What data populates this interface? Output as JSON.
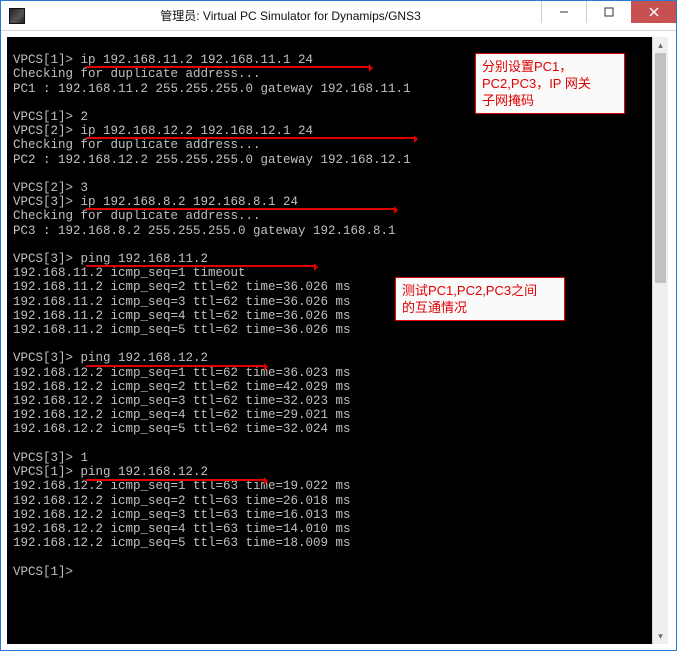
{
  "window": {
    "title": "管理员:  Virtual PC Simulator for Dynamips/GNS3"
  },
  "annotations": {
    "a1": "分别设置PC1，\nPC2,PC3，IP 网关\n子网掩码",
    "a2": "测试PC1,PC2,PC3之间\n的互通情况"
  },
  "terminal": {
    "lines": [
      "",
      "VPCS[1]> ip 192.168.11.2 192.168.11.1 24",
      "Checking for duplicate address...",
      "PC1 : 192.168.11.2 255.255.255.0 gateway 192.168.11.1",
      "",
      "VPCS[1]> 2",
      "VPCS[2]> ip 192.168.12.2 192.168.12.1 24",
      "Checking for duplicate address...",
      "PC2 : 192.168.12.2 255.255.255.0 gateway 192.168.12.1",
      "",
      "VPCS[2]> 3",
      "VPCS[3]> ip 192.168.8.2 192.168.8.1 24",
      "Checking for duplicate address...",
      "PC3 : 192.168.8.2 255.255.255.0 gateway 192.168.8.1",
      "",
      "VPCS[3]> ping 192.168.11.2",
      "192.168.11.2 icmp_seq=1 timeout",
      "192.168.11.2 icmp_seq=2 ttl=62 time=36.026 ms",
      "192.168.11.2 icmp_seq=3 ttl=62 time=36.026 ms",
      "192.168.11.2 icmp_seq=4 ttl=62 time=36.026 ms",
      "192.168.11.2 icmp_seq=5 ttl=62 time=36.026 ms",
      "",
      "VPCS[3]> ping 192.168.12.2",
      "192.168.12.2 icmp_seq=1 ttl=62 time=36.023 ms",
      "192.168.12.2 icmp_seq=2 ttl=62 time=42.029 ms",
      "192.168.12.2 icmp_seq=3 ttl=62 time=32.023 ms",
      "192.168.12.2 icmp_seq=4 ttl=62 time=29.021 ms",
      "192.168.12.2 icmp_seq=5 ttl=62 time=32.024 ms",
      "",
      "VPCS[3]> 1",
      "VPCS[1]> ping 192.168.12.2",
      "192.168.12.2 icmp_seq=1 ttl=63 time=19.022 ms",
      "192.168.12.2 icmp_seq=2 ttl=63 time=26.018 ms",
      "192.168.12.2 icmp_seq=3 ttl=63 time=16.013 ms",
      "192.168.12.2 icmp_seq=4 ttl=63 time=14.010 ms",
      "192.168.12.2 icmp_seq=5 ttl=63 time=18.009 ms",
      "",
      "VPCS[1]>"
    ]
  }
}
